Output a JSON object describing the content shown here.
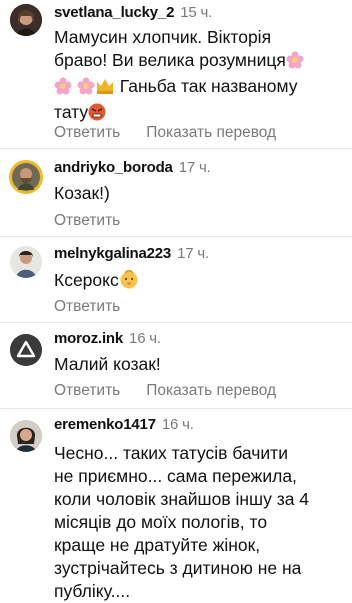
{
  "comments": [
    {
      "username": "svetlana_lucky_2",
      "time": "15 ч.",
      "text_line1": "Мамусин хлопчик. Вікторія",
      "text_line2": "браво! Ви велика розумниця",
      "text_line3_suffix": " Ганьба так названому",
      "text_line4": "тату",
      "reply": "Ответить",
      "translate": "Показать перевод"
    },
    {
      "username": "andriyko_boroda",
      "time": "17 ч.",
      "text": "Козак!)",
      "reply": "Ответить"
    },
    {
      "username": "melnykgalina223",
      "time": "17 ч.",
      "text": "Ксерокс",
      "reply": "Ответить"
    },
    {
      "username": "moroz.ink",
      "time": "16 ч.",
      "text": "Малий козак!",
      "reply": "Ответить",
      "translate": "Показать перевод"
    },
    {
      "username": "eremenko1417",
      "time": "16 ч.",
      "lines": [
        "Чесно... таких татусів бачити",
        "не приємно... сама пережила,",
        "коли чоловік знайшов іншу за 4",
        "місяців до моїх пологів, то",
        "краще не дратуйте жінок,",
        "зустрічайтесь з дитиною не на",
        "публіку...."
      ]
    }
  ]
}
